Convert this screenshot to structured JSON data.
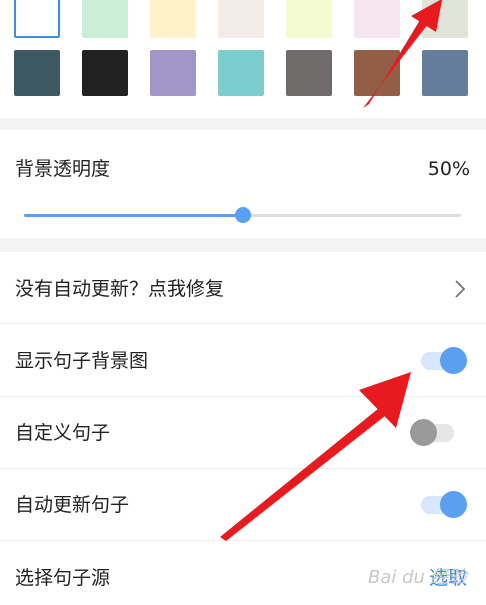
{
  "colors": {
    "accent": "#5b9ff0",
    "link": "#3a88e0",
    "arrow": "#e8191f"
  },
  "swatches": {
    "row1": [
      "#ffffff",
      "#c9efd7",
      "#fff1c9",
      "#f3ece8",
      "#f4fbd1",
      "#f7e5ef",
      "#dfe3d8"
    ],
    "row2": [
      "#3d5861",
      "#222222",
      "#a295c8",
      "#7ccdcd",
      "#6f6b6b",
      "#935d46",
      "#667c9c"
    ],
    "selected_index": 0
  },
  "opacity": {
    "label": "背景透明度",
    "value_text": "50%",
    "value": 0.5
  },
  "settings": {
    "fix_update": {
      "label": "没有自动更新？点我修复",
      "icon": "chevron-right-icon"
    },
    "show_bg_image": {
      "label": "显示句子背景图",
      "on": true
    },
    "custom_sentence": {
      "label": "自定义句子",
      "on": false
    },
    "auto_update": {
      "label": "自动更新句子",
      "on": true
    },
    "sentence_source": {
      "label": "选择句子源",
      "action": "选取"
    }
  },
  "watermark": {
    "text": "Bai du 经验"
  }
}
